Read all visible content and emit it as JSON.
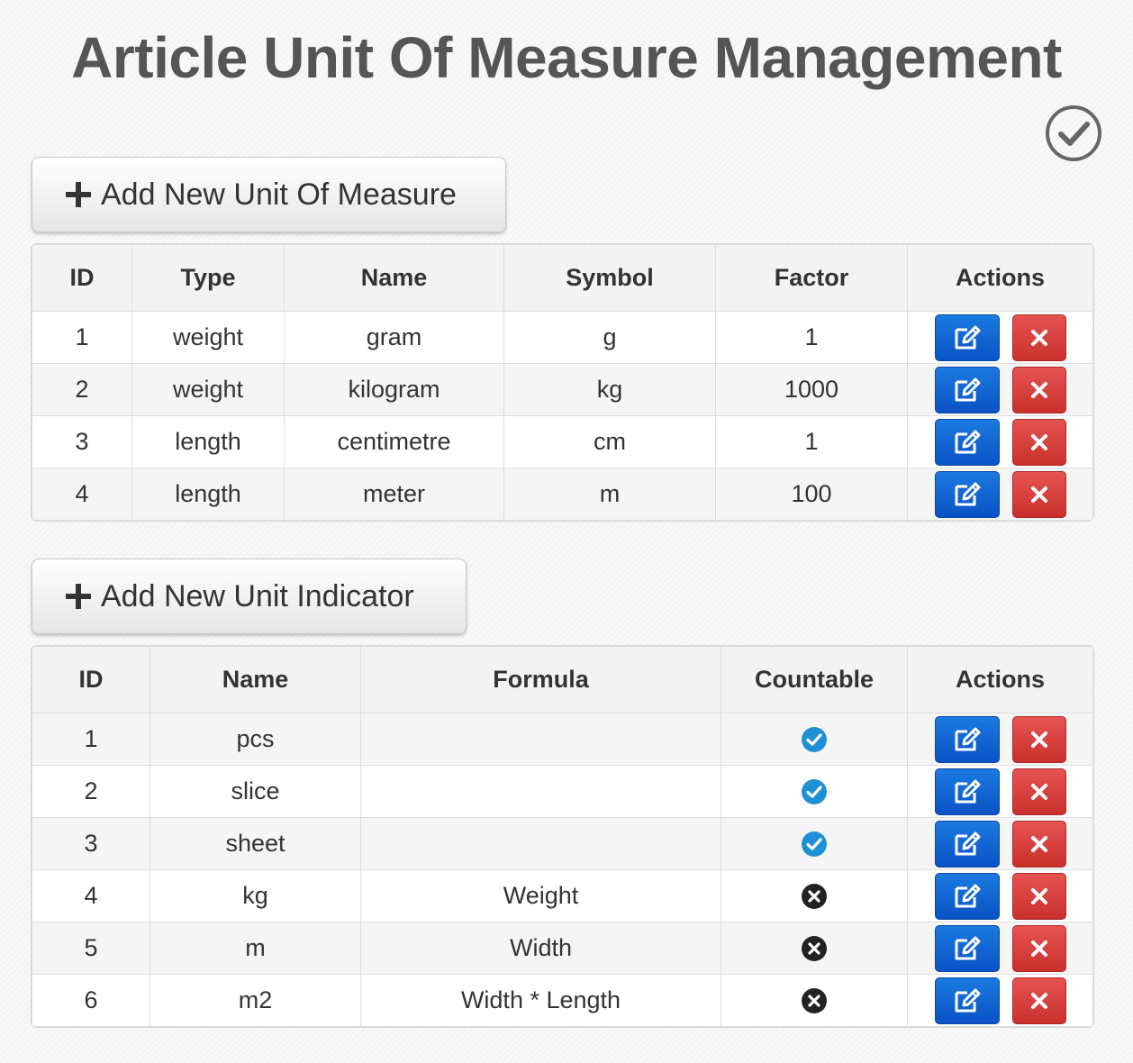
{
  "page": {
    "title": "Article Unit Of Measure Management"
  },
  "uom_section": {
    "add_label": "Add New Unit Of Measure",
    "headers": [
      "ID",
      "Type",
      "Name",
      "Symbol",
      "Factor",
      "Actions"
    ],
    "rows": [
      {
        "id": "1",
        "type": "weight",
        "name": "gram",
        "symbol": "g",
        "factor": "1"
      },
      {
        "id": "2",
        "type": "weight",
        "name": "kilogram",
        "symbol": "kg",
        "factor": "1000"
      },
      {
        "id": "3",
        "type": "length",
        "name": "centimetre",
        "symbol": "cm",
        "factor": "1"
      },
      {
        "id": "4",
        "type": "length",
        "name": "meter",
        "symbol": "m",
        "factor": "100"
      }
    ]
  },
  "indicator_section": {
    "add_label": "Add New Unit Indicator",
    "headers": [
      "ID",
      "Name",
      "Formula",
      "Countable",
      "Actions"
    ],
    "rows": [
      {
        "id": "1",
        "name": "pcs",
        "formula": "",
        "countable": true
      },
      {
        "id": "2",
        "name": "slice",
        "formula": "",
        "countable": true
      },
      {
        "id": "3",
        "name": "sheet",
        "formula": "",
        "countable": true
      },
      {
        "id": "4",
        "name": "kg",
        "formula": "Weight",
        "countable": false
      },
      {
        "id": "5",
        "name": "m",
        "formula": "Width",
        "countable": false
      },
      {
        "id": "6",
        "name": "m2",
        "formula": "Width * Length",
        "countable": false
      }
    ]
  },
  "icons": {
    "top_right": "circle-check-icon",
    "add": "plus-icon",
    "edit": "edit-icon",
    "delete": "times-icon",
    "countable_true": "check-circle-icon",
    "countable_false": "times-circle-icon"
  },
  "colors": {
    "title": "#555555",
    "edit_button": "#0a5fd0",
    "delete_button": "#d63c39",
    "countable_true": "#1e90d6",
    "countable_false": "#222222"
  }
}
